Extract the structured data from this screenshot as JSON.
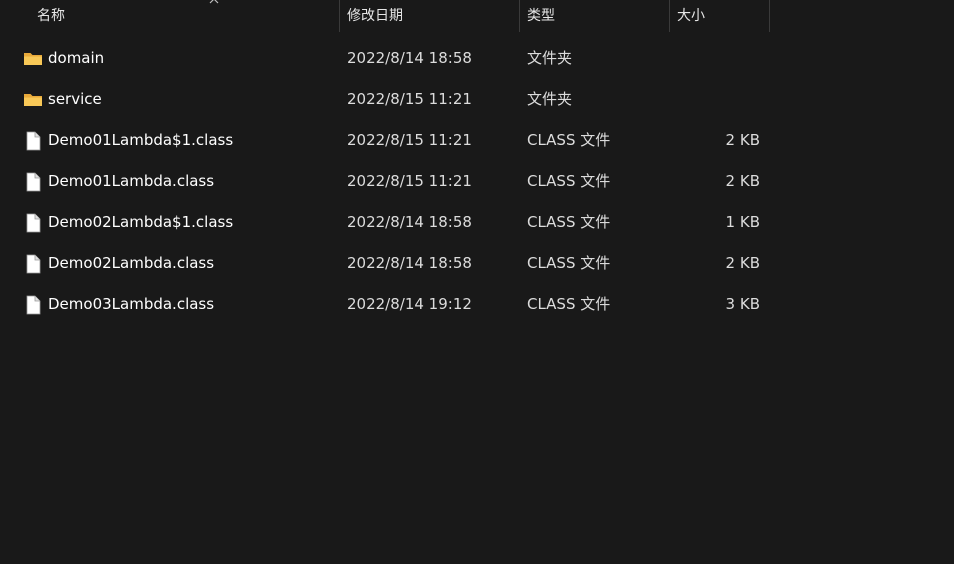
{
  "columns": {
    "name": "名称",
    "date": "修改日期",
    "type": "类型",
    "size": "大小"
  },
  "rows": [
    {
      "icon": "folder-icon",
      "name": "domain",
      "date": "2022/8/14 18:58",
      "type": "文件夹",
      "size": ""
    },
    {
      "icon": "folder-icon",
      "name": "service",
      "date": "2022/8/15 11:21",
      "type": "文件夹",
      "size": ""
    },
    {
      "icon": "file-icon",
      "name": "Demo01Lambda$1.class",
      "date": "2022/8/15 11:21",
      "type": "CLASS 文件",
      "size": "2 KB"
    },
    {
      "icon": "file-icon",
      "name": "Demo01Lambda.class",
      "date": "2022/8/15 11:21",
      "type": "CLASS 文件",
      "size": "2 KB"
    },
    {
      "icon": "file-icon",
      "name": "Demo02Lambda$1.class",
      "date": "2022/8/14 18:58",
      "type": "CLASS 文件",
      "size": "1 KB"
    },
    {
      "icon": "file-icon",
      "name": "Demo02Lambda.class",
      "date": "2022/8/14 18:58",
      "type": "CLASS 文件",
      "size": "2 KB"
    },
    {
      "icon": "file-icon",
      "name": "Demo03Lambda.class",
      "date": "2022/8/14 19:12",
      "type": "CLASS 文件",
      "size": "3 KB"
    }
  ],
  "colors": {
    "background": "#191919",
    "folder": "#f5c04a",
    "file": "#ffffff"
  }
}
